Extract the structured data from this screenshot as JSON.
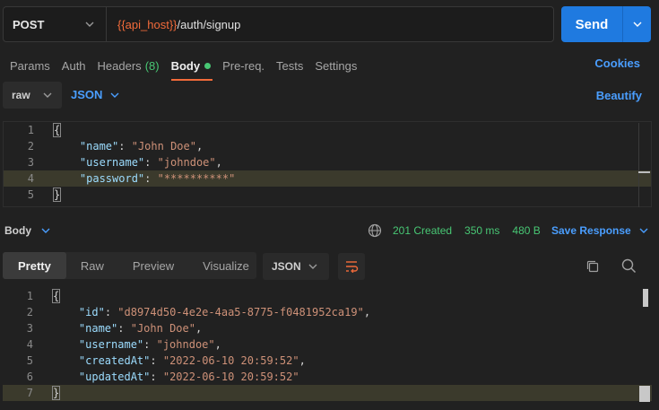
{
  "request": {
    "method": "POST",
    "url_var": "{{api_host}}",
    "url_path": "/auth/signup",
    "send_label": "Send"
  },
  "req_tabs": [
    {
      "label": "Params"
    },
    {
      "label": "Auth"
    },
    {
      "label": "Headers",
      "count": "(8)"
    },
    {
      "label": "Body"
    },
    {
      "label": "Pre-req."
    },
    {
      "label": "Tests"
    },
    {
      "label": "Settings"
    }
  ],
  "cookies_label": "Cookies",
  "body_mode": "raw",
  "body_format": "JSON",
  "beautify_label": "Beautify",
  "request_body": [
    {
      "n": "1",
      "text": "{"
    },
    {
      "n": "2",
      "key": "\"name\"",
      "val": "\"John Doe\"",
      "end": ","
    },
    {
      "n": "3",
      "key": "\"username\"",
      "val": "\"johndoe\"",
      "end": ","
    },
    {
      "n": "4",
      "key": "\"password\"",
      "val": "\"**********\"",
      "end": ""
    },
    {
      "n": "5",
      "text": "}"
    }
  ],
  "response": {
    "section_label": "Body",
    "status": "201 Created",
    "time": "350 ms",
    "size": "480 B",
    "save_label": "Save Response",
    "tabs": [
      {
        "label": "Pretty"
      },
      {
        "label": "Raw"
      },
      {
        "label": "Preview"
      },
      {
        "label": "Visualize"
      }
    ],
    "format": "JSON",
    "lines": [
      {
        "n": "1",
        "text": "{"
      },
      {
        "n": "2",
        "key": "\"id\"",
        "val": "\"d8974d50-4e2e-4aa5-8775-f0481952ca19\"",
        "end": ","
      },
      {
        "n": "3",
        "key": "\"name\"",
        "val": "\"John Doe\"",
        "end": ","
      },
      {
        "n": "4",
        "key": "\"username\"",
        "val": "\"johndoe\"",
        "end": ","
      },
      {
        "n": "5",
        "key": "\"createdAt\"",
        "val": "\"2022-06-10 20:59:52\"",
        "end": ","
      },
      {
        "n": "6",
        "key": "\"updatedAt\"",
        "val": "\"2022-06-10 20:59:52\"",
        "end": ""
      },
      {
        "n": "7",
        "text": "}"
      }
    ]
  },
  "colors": {
    "accent": "#1f7ae0",
    "link": "#4a9eff",
    "success": "#48c774",
    "tab_underline": "#f26b3a"
  }
}
